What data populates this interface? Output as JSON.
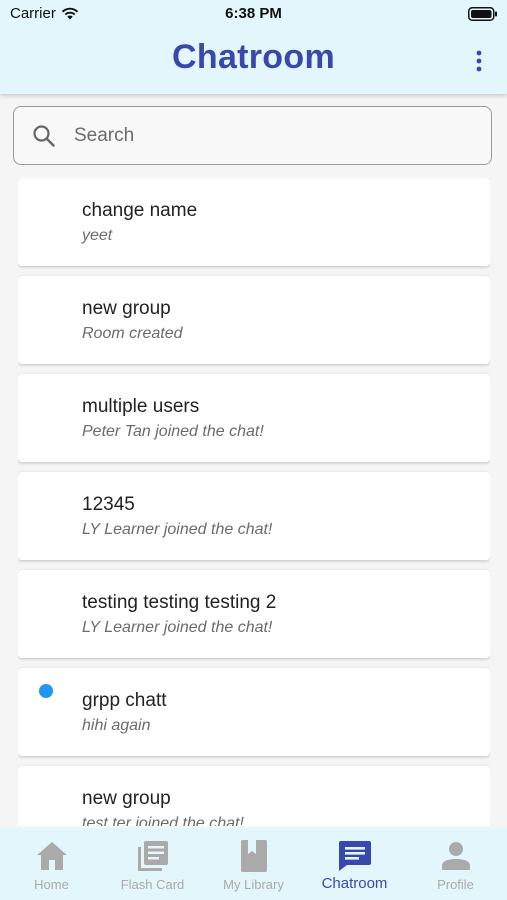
{
  "status_bar": {
    "carrier": "Carrier",
    "time": "6:38 PM"
  },
  "header": {
    "title": "Chatroom",
    "menu_icon": "more-vert-icon"
  },
  "search": {
    "placeholder": "Search",
    "value": ""
  },
  "rooms": [
    {
      "name": "change name",
      "last_message": "yeet",
      "unread": false
    },
    {
      "name": "new group",
      "last_message": "Room created",
      "unread": false
    },
    {
      "name": "multiple users",
      "last_message": "Peter Tan joined the chat!",
      "unread": false
    },
    {
      "name": "12345",
      "last_message": "LY Learner joined the chat!",
      "unread": false
    },
    {
      "name": "testing testing testing 2",
      "last_message": "LY Learner joined the chat!",
      "unread": false
    },
    {
      "name": "grpp chatt",
      "last_message": "hihi again",
      "unread": true
    },
    {
      "name": "new group",
      "last_message": "test ter joined the chat!",
      "unread": false
    }
  ],
  "tabs": [
    {
      "label": "Home",
      "icon": "home-icon",
      "active": false
    },
    {
      "label": "Flash Card",
      "icon": "library-books-icon",
      "active": false
    },
    {
      "label": "My Library",
      "icon": "book-icon",
      "active": false
    },
    {
      "label": "Chatroom",
      "icon": "chat-icon",
      "active": true
    },
    {
      "label": "Profile",
      "icon": "person-icon",
      "active": false
    }
  ],
  "colors": {
    "accent": "#3949ab",
    "header_bg": "#e3f6fb",
    "unread_dot": "#2196f3",
    "inactive_tab": "#aaaaaa"
  }
}
